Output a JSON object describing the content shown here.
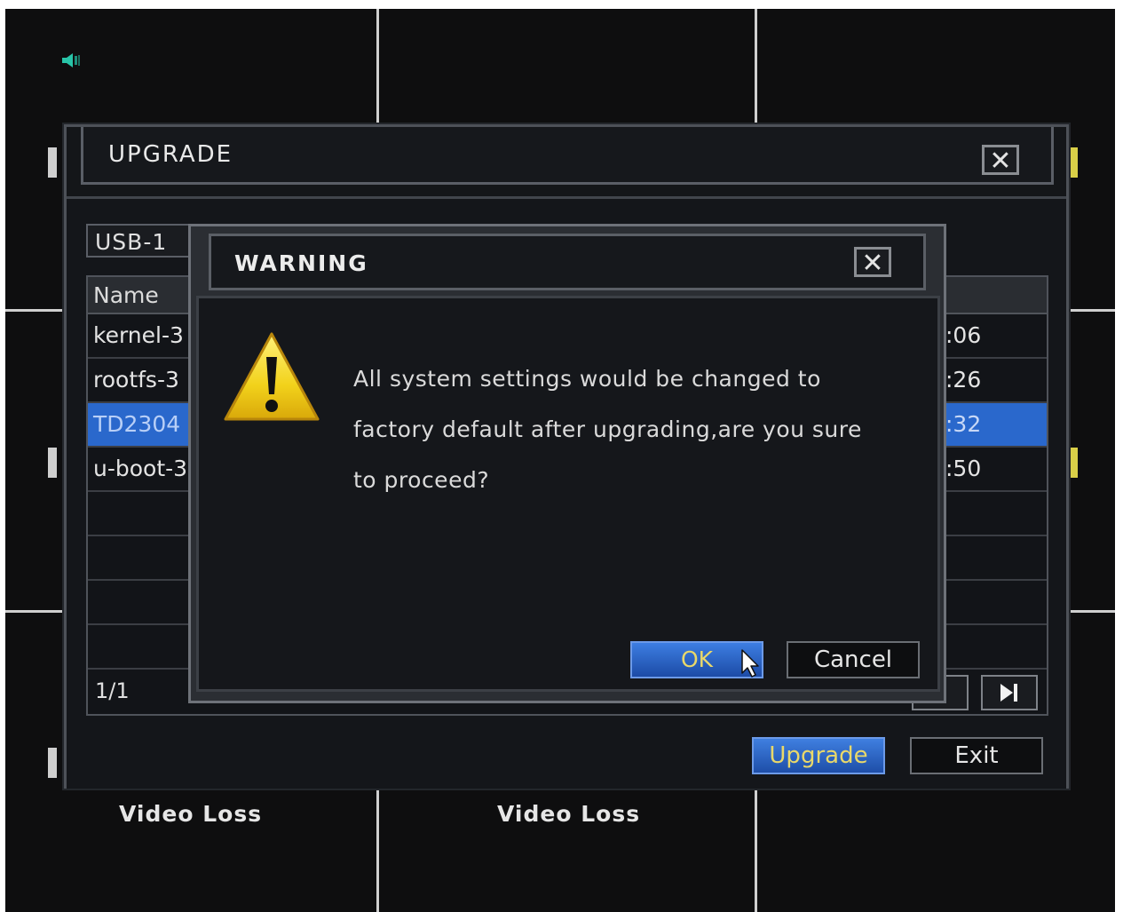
{
  "background": {
    "video_loss_labels": [
      "Video Loss",
      "Video Loss"
    ]
  },
  "upgrade_window": {
    "title": "UPGRADE",
    "device_select_value": "USB-1",
    "table": {
      "column_name": "Name",
      "rows": [
        {
          "name": "kernel-3",
          "time": ":06",
          "selected": false
        },
        {
          "name": "rootfs-3",
          "time": ":26",
          "selected": false
        },
        {
          "name": "TD2304",
          "time": ":32",
          "selected": true
        },
        {
          "name": "u-boot-3",
          "time": ":50",
          "selected": false
        }
      ],
      "page": "1/1"
    },
    "upgrade_label": "Upgrade",
    "exit_label": "Exit"
  },
  "warning_dialog": {
    "title": "WARNING",
    "message_lines": [
      "All system settings would be changed to",
      "factory default after upgrading,are you sure",
      "to proceed?"
    ],
    "ok_label": "OK",
    "cancel_label": "Cancel"
  },
  "colors": {
    "screen_bg": "#0e0e0f",
    "selected_row": "#2a68cc",
    "button_blue": "#2f66c8",
    "button_text_yellow": "#e9d86a",
    "warning_yellow": "#f2d21b"
  }
}
